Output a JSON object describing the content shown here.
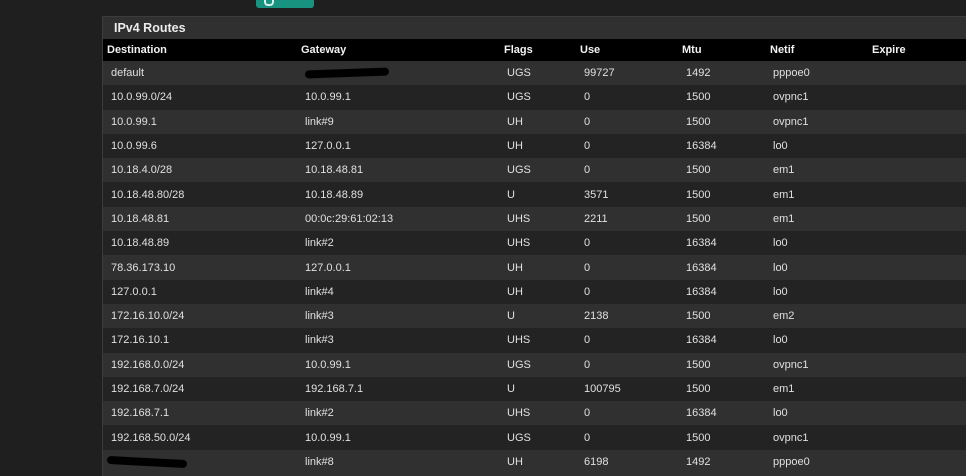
{
  "panel": {
    "title": "IPv4 Routes"
  },
  "columns": [
    "Destination",
    "Gateway",
    "Flags",
    "Use",
    "Mtu",
    "Netif",
    "Expire"
  ],
  "rows": [
    {
      "destination": "default",
      "gateway": "",
      "flags": "UGS",
      "use": "99727",
      "mtu": "1492",
      "netif": "pppoe0",
      "expire": ""
    },
    {
      "destination": "10.0.99.0/24",
      "gateway": "10.0.99.1",
      "flags": "UGS",
      "use": "0",
      "mtu": "1500",
      "netif": "ovpnc1",
      "expire": ""
    },
    {
      "destination": "10.0.99.1",
      "gateway": "link#9",
      "flags": "UH",
      "use": "0",
      "mtu": "1500",
      "netif": "ovpnc1",
      "expire": ""
    },
    {
      "destination": "10.0.99.6",
      "gateway": "127.0.0.1",
      "flags": "UH",
      "use": "0",
      "mtu": "16384",
      "netif": "lo0",
      "expire": ""
    },
    {
      "destination": "10.18.4.0/28",
      "gateway": "10.18.48.81",
      "flags": "UGS",
      "use": "0",
      "mtu": "1500",
      "netif": "em1",
      "expire": ""
    },
    {
      "destination": "10.18.48.80/28",
      "gateway": "10.18.48.89",
      "flags": "U",
      "use": "3571",
      "mtu": "1500",
      "netif": "em1",
      "expire": ""
    },
    {
      "destination": "10.18.48.81",
      "gateway": "00:0c:29:61:02:13",
      "flags": "UHS",
      "use": "2211",
      "mtu": "1500",
      "netif": "em1",
      "expire": ""
    },
    {
      "destination": "10.18.48.89",
      "gateway": "link#2",
      "flags": "UHS",
      "use": "0",
      "mtu": "16384",
      "netif": "lo0",
      "expire": ""
    },
    {
      "destination": "78.36.173.10",
      "gateway": "127.0.0.1",
      "flags": "UH",
      "use": "0",
      "mtu": "16384",
      "netif": "lo0",
      "expire": ""
    },
    {
      "destination": "127.0.0.1",
      "gateway": "link#4",
      "flags": "UH",
      "use": "0",
      "mtu": "16384",
      "netif": "lo0",
      "expire": ""
    },
    {
      "destination": "172.16.10.0/24",
      "gateway": "link#3",
      "flags": "U",
      "use": "2138",
      "mtu": "1500",
      "netif": "em2",
      "expire": ""
    },
    {
      "destination": "172.16.10.1",
      "gateway": "link#3",
      "flags": "UHS",
      "use": "0",
      "mtu": "16384",
      "netif": "lo0",
      "expire": ""
    },
    {
      "destination": "192.168.0.0/24",
      "gateway": "10.0.99.1",
      "flags": "UGS",
      "use": "0",
      "mtu": "1500",
      "netif": "ovpnc1",
      "expire": ""
    },
    {
      "destination": "192.168.7.0/24",
      "gateway": "192.168.7.1",
      "flags": "U",
      "use": "100795",
      "mtu": "1500",
      "netif": "em1",
      "expire": ""
    },
    {
      "destination": "192.168.7.1",
      "gateway": "link#2",
      "flags": "UHS",
      "use": "0",
      "mtu": "16384",
      "netif": "lo0",
      "expire": ""
    },
    {
      "destination": "192.168.50.0/24",
      "gateway": "10.0.99.1",
      "flags": "UGS",
      "use": "0",
      "mtu": "1500",
      "netif": "ovpnc1",
      "expire": ""
    },
    {
      "destination": "",
      "gateway": "link#8",
      "flags": "UH",
      "use": "6198",
      "mtu": "1492",
      "netif": "pppoe0",
      "expire": ""
    }
  ],
  "colors": {
    "accent": "#17937f",
    "header_bg": "#000000",
    "row_odd": "#303030",
    "row_even": "#232323"
  }
}
